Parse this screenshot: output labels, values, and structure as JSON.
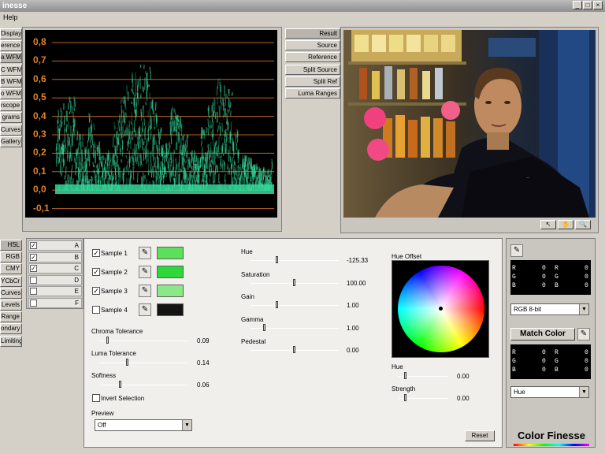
{
  "window": {
    "title": "inesse",
    "menu": [
      "Help"
    ]
  },
  "left_tools": [
    "Display",
    "erence",
    "a WFM",
    "C WFM",
    "B WFM",
    "o WFM",
    "rscope",
    "grams",
    "Curves",
    "Gallery"
  ],
  "left_tools_active": [
    false,
    false,
    true,
    false,
    false,
    false,
    false,
    false,
    false,
    false
  ],
  "left_tabs": [
    "HSL",
    "RGB",
    "CMY",
    "YCbCr",
    "Curves",
    "Levels",
    "Range",
    "ondary",
    "Limiting"
  ],
  "left_tabs_active": [
    true,
    false,
    false,
    false,
    false,
    false,
    false,
    false,
    false
  ],
  "waveform": {
    "ticks": [
      "0,8",
      "0,7",
      "0,6",
      "0,5",
      "0,4",
      "0,3",
      "0,2",
      "0,1",
      "0,0",
      "-0,1"
    ],
    "trace_color": "#35d89a",
    "line_color": "#c0602a"
  },
  "view_buttons": [
    "Result",
    "Source",
    "Reference",
    "Split Source",
    "Split Ref",
    "Luma Ranges"
  ],
  "view_active": [
    true,
    false,
    false,
    false,
    false,
    false
  ],
  "sample_rows": [
    {
      "label": "A",
      "checked": true
    },
    {
      "label": "B",
      "checked": true
    },
    {
      "label": "C",
      "checked": true
    },
    {
      "label": "D",
      "checked": false
    },
    {
      "label": "E",
      "checked": false
    },
    {
      "label": "F",
      "checked": false
    }
  ],
  "samples": [
    {
      "label": "Sample 1",
      "checked": true,
      "color": "#5ce05c"
    },
    {
      "label": "Sample 2",
      "checked": true,
      "color": "#2ed83a"
    },
    {
      "label": "Sample 3",
      "checked": true,
      "color": "#8ae888"
    },
    {
      "label": "Sample 4",
      "checked": false,
      "color": "#141414"
    }
  ],
  "tolerances": [
    {
      "label": "Chroma Tolerance",
      "value": "0.09",
      "level": 0.1
    },
    {
      "label": "Luma Tolerance",
      "value": "0.14",
      "level": 0.32
    },
    {
      "label": "Softness",
      "value": "0.06",
      "level": 0.24
    }
  ],
  "invert_selection": {
    "label": "Invert Selection",
    "checked": false
  },
  "preview": {
    "label": "Preview",
    "value": "Off"
  },
  "adjust": [
    {
      "label": "Hue",
      "value": "-125.33",
      "level": 0.3
    },
    {
      "label": "Saturation",
      "value": "100.00",
      "level": 0.5
    },
    {
      "label": "Gain",
      "value": "1.00",
      "level": 0.3
    },
    {
      "label": "Gamma",
      "value": "1.00",
      "level": 0.16
    },
    {
      "label": "Pedestal",
      "value": "0.00",
      "level": 0.5
    }
  ],
  "hue_offset": {
    "label": "Hue Offset"
  },
  "offset_sliders": [
    {
      "label": "Hue",
      "value": "0.00",
      "level": 0.15
    },
    {
      "label": "Strength",
      "value": "0.00",
      "level": 0.15
    }
  ],
  "reset_label": "Reset",
  "rgb_readout_1": {
    "rows": [
      [
        "R",
        "0",
        "R",
        "0"
      ],
      [
        "G",
        "0",
        "G",
        "0"
      ],
      [
        "B",
        "0",
        "B",
        "0"
      ]
    ]
  },
  "rgb_mode": "RGB 8-bit",
  "match_color_label": "Match Color",
  "rgb_readout_2": {
    "rows": [
      [
        "R",
        "0",
        "R",
        "0"
      ],
      [
        "G",
        "0",
        "G",
        "0"
      ],
      [
        "B",
        "0",
        "B",
        "0"
      ]
    ]
  },
  "match_mode": "Hue",
  "brand": {
    "text": "Color Finesse"
  },
  "viewer_tools": [
    "arrow-icon",
    "hand-icon",
    "zoom-icon"
  ]
}
